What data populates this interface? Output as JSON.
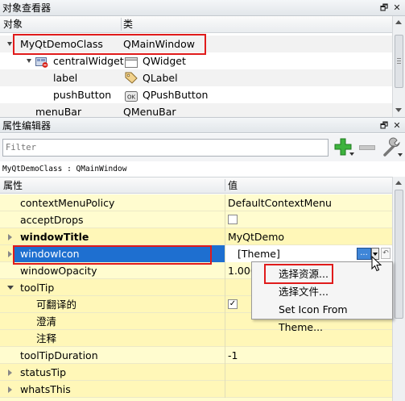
{
  "object_inspector": {
    "title": "对象查看器",
    "col_object": "对象",
    "col_class": "类",
    "rows": [
      {
        "name": "MyQtDemoClass",
        "cls": "QMainWindow"
      },
      {
        "name": "centralWidget",
        "cls": "QWidget"
      },
      {
        "name": "label",
        "cls": "QLabel"
      },
      {
        "name": "pushButton",
        "cls": "QPushButton"
      },
      {
        "name": "menuBar",
        "cls": "QMenuBar"
      }
    ],
    "float_glyph": "🗗",
    "close_glyph": "✕"
  },
  "property_editor": {
    "title": "属性编辑器",
    "filter_placeholder": "Filter",
    "context_label": "MyQtDemoClass : QMainWindow",
    "col_property": "属性",
    "col_value": "值",
    "float_glyph": "🗗",
    "close_glyph": "✕",
    "rows": [
      {
        "name": "contextMenuPolicy",
        "value": "DefaultContextMenu"
      },
      {
        "name": "acceptDrops",
        "value": ""
      },
      {
        "name": "windowTitle",
        "value": "MyQtDemo"
      },
      {
        "name": "windowIcon",
        "value": "[Theme]"
      },
      {
        "name": "windowOpacity",
        "value": "1.000"
      },
      {
        "name": "toolTip",
        "value": ""
      },
      {
        "name": "可翻译的",
        "value": ""
      },
      {
        "name": "澄清",
        "value": ""
      },
      {
        "name": "注释",
        "value": ""
      },
      {
        "name": "toolTipDuration",
        "value": "-1"
      },
      {
        "name": "statusTip",
        "value": ""
      },
      {
        "name": "whatsThis",
        "value": ""
      }
    ],
    "ellipsis_label": "...",
    "accept_drops_checked": false,
    "translatable_checked": true
  },
  "context_menu": {
    "items": [
      {
        "label": "选择资源..."
      },
      {
        "label": "选择文件..."
      },
      {
        "label": "Set Icon From Theme..."
      }
    ]
  },
  "colors": {
    "highlight": "#1e6fd0",
    "annotation_red": "#e01b1b",
    "row_yellow": "#fffccf"
  }
}
